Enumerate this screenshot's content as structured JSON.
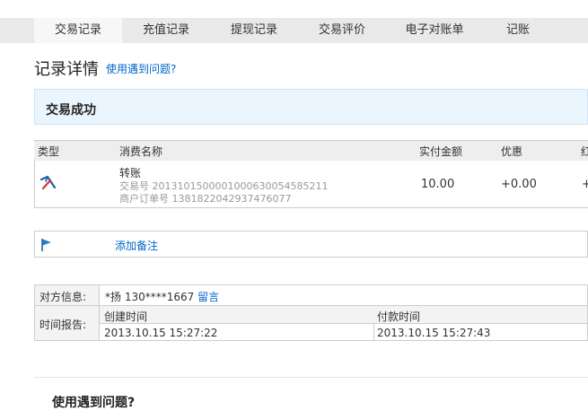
{
  "tabs": [
    {
      "label": "交易记录",
      "active": true
    },
    {
      "label": "充值记录"
    },
    {
      "label": "提现记录"
    },
    {
      "label": "交易评价"
    },
    {
      "label": "电子对账单"
    },
    {
      "label": "记账"
    }
  ],
  "header": {
    "title": "记录详情",
    "help_link": "使用遇到问题?"
  },
  "status": {
    "text": "交易成功"
  },
  "table": {
    "columns": [
      "类型",
      "消费名称",
      "实付金额",
      "优惠",
      "红"
    ],
    "row": {
      "icon": "transfer-icon",
      "name": "转账",
      "trade_no": "交易号 2013101500001000630054585211",
      "order_no": "商户订单号 1381822042937476077",
      "amount": "10.00",
      "discount": "+0.00",
      "extra": "+"
    }
  },
  "note": {
    "icon": "flag-icon",
    "link": "添加备注"
  },
  "counterparty": {
    "label": "对方信息:",
    "value": "*扬 130****1667",
    "link": "留言"
  },
  "time_report": {
    "label": "时间报告:",
    "created_label": "创建时间",
    "paid_label": "付款时间",
    "created_value": "2013.10.15 15:27:22",
    "paid_value": "2013.10.15 15:27:43"
  },
  "faq": {
    "title": "使用遇到问题?"
  },
  "colors": {
    "accent": "#0066cc",
    "status_bg": "#eaf5fd",
    "tab_bg": "#e9e9e9"
  }
}
